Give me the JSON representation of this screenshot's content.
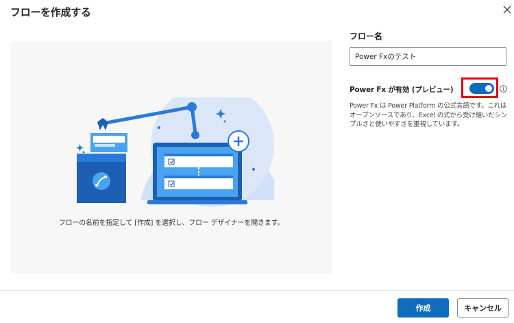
{
  "dialog": {
    "title": "フローを作成する"
  },
  "illustration": {
    "caption": "フローの名前を指定して [作成] を選択し、フロー デザイナーを開きます。"
  },
  "form": {
    "flow_name_label": "フロー名",
    "flow_name_value": "Power Fxのテスト",
    "powerfx_label": "Power Fx が有効 (プレビュー)",
    "powerfx_enabled": true,
    "powerfx_description": "Power Fx は Power Platform の公式言語です。これはオープンソースであり、Excel の式から受け継いだシンプルさと使いやすさを重視しています。"
  },
  "footer": {
    "create_label": "作成",
    "cancel_label": "キャンセル"
  },
  "icons": {
    "close": "close-icon",
    "info": "info-icon"
  },
  "colors": {
    "accent": "#0f6cbd",
    "highlight": "#e8000e"
  }
}
